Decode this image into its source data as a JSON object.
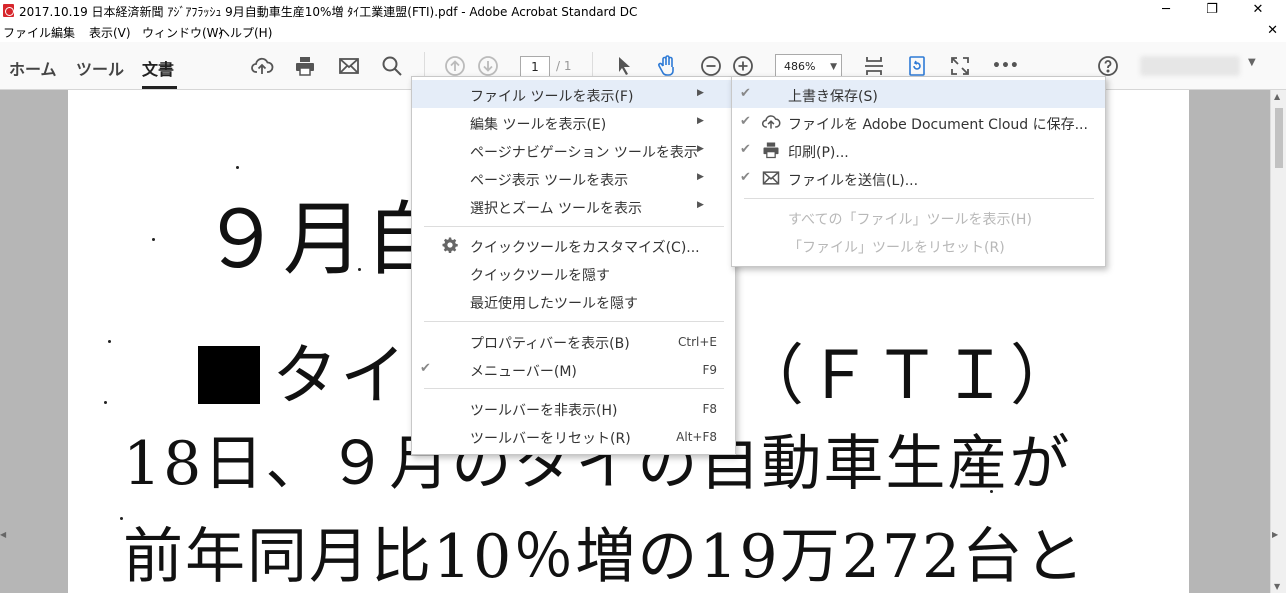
{
  "window": {
    "title": "2017.10.19 日本経済新聞 ｱｼﾞｱﾌﾗｯｼｭ 9月自動車生産10%増 ﾀｲ工業連盟(FTI).pdf - Adobe Acrobat Standard DC",
    "minimize": "─",
    "restore": "❐",
    "close": "✕"
  },
  "menubar": {
    "items": [
      "ファイル",
      "編集",
      "表示(V)",
      "ウィンドウ(W)",
      "ヘルプ(H)"
    ],
    "close_doc": "✕"
  },
  "toolbar": {
    "tabs": [
      "ホーム",
      "ツール",
      "文書"
    ],
    "page_current": "1",
    "page_total": "/ 1",
    "zoom": "486%",
    "more": "•••"
  },
  "document": {
    "line1": "９月自",
    "line2": "タイ",
    "line2b": "（ＦＴＩ）",
    "line3": "18日、９月のタイの自動車生産が",
    "line4": "前年同月比10％増の19万272台と"
  },
  "context_menu": {
    "items": [
      {
        "label": "ファイル ツールを表示(F)",
        "submenu": true
      },
      {
        "label": "編集 ツールを表示(E)",
        "submenu": true
      },
      {
        "label": "ページナビゲーション ツールを表示",
        "submenu": true
      },
      {
        "label": "ページ表示 ツールを表示",
        "submenu": true
      },
      {
        "label": "選択とズーム ツールを表示",
        "submenu": true
      },
      {
        "label": "クイックツールをカスタマイズ(C)..."
      },
      {
        "label": "クイックツールを隠す"
      },
      {
        "label": "最近使用したツールを隠す"
      },
      {
        "label": "プロパティバーを表示(B)",
        "shortcut": "Ctrl+E"
      },
      {
        "label": "メニューバー(M)",
        "shortcut": "F9",
        "checked": true
      },
      {
        "label": "ツールバーを非表示(H)",
        "shortcut": "F8"
      },
      {
        "label": "ツールバーをリセット(R)",
        "shortcut": "Alt+F8"
      }
    ]
  },
  "submenu": {
    "items": [
      {
        "label": "上書き保存(S)",
        "checked": true
      },
      {
        "label": "ファイルを Adobe Document Cloud に保存...",
        "checked": true
      },
      {
        "label": "印刷(P)...",
        "checked": true
      },
      {
        "label": "ファイルを送信(L)...",
        "checked": true
      },
      {
        "label": "すべての「ファイル」ツールを表示(H)",
        "disabled": true
      },
      {
        "label": "「ファイル」ツールをリセット(R)",
        "disabled": true
      }
    ]
  },
  "glyphs": {
    "check": "✔",
    "submenu_arrow": "▶",
    "caret": "▼",
    "scroll_up": "▲",
    "scroll_down": "▼",
    "collapse_left": "◀",
    "collapse_right": "▶"
  },
  "colors": {
    "menu_hover": "#e5edf8",
    "disabled_text": "#b8b8b8",
    "canvas": "#b6b6b6",
    "acrobat_red": "#d7262c"
  }
}
